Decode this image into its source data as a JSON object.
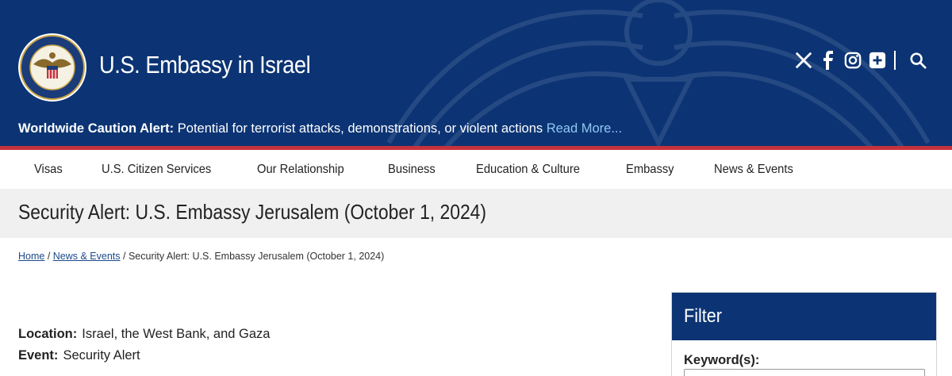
{
  "header": {
    "site_title": "U.S. Embassy in Israel",
    "seal_text": "DEPARTMENT OF STATE • UNITED STATES OF AMERICA",
    "social": [
      "x-icon",
      "facebook-icon",
      "instagram-icon",
      "flickr-plus-icon",
      "search-icon"
    ]
  },
  "alert": {
    "label": "Worldwide Caution Alert:",
    "text": " Potential for terrorist attacks, demonstrations, or violent actions ",
    "link": "Read More..."
  },
  "nav": {
    "items": [
      "Visas",
      "U.S. Citizen Services",
      "Our Relationship",
      "Business",
      "Education & Culture",
      "Embassy",
      "News & Events"
    ]
  },
  "page": {
    "title": "Security Alert: U.S. Embassy Jerusalem (October 1, 2024)"
  },
  "breadcrumb": {
    "home": "Home",
    "sep": " / ",
    "section": "News & Events",
    "current": "Security Alert: U.S. Embassy Jerusalem (October 1, 2024)"
  },
  "content": {
    "location_label": "Location:",
    "location_value": "Israel, the West Bank, and Gaza",
    "event_label": "Event:",
    "event_value": "Security Alert"
  },
  "filter": {
    "title": "Filter",
    "keyword_label": "Keyword(s):",
    "keyword_value": ""
  },
  "colors": {
    "header_bg": "#0c3474",
    "alert_rule": "#c6323c",
    "link_light": "#8fc7f2",
    "title_band": "#f0f0f0"
  }
}
